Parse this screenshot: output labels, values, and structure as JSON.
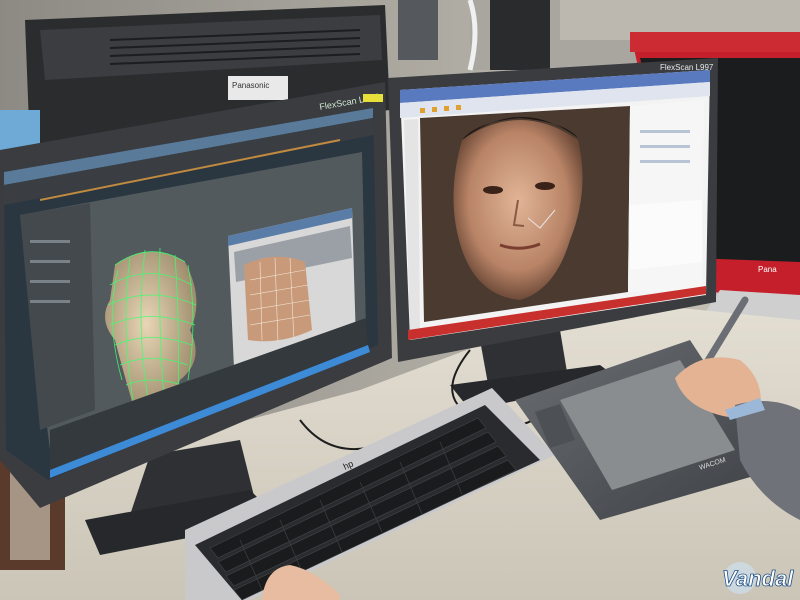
{
  "scene": {
    "left_monitor_brand": "FlexScan L997",
    "right_monitor_brand": "FlexScan L997",
    "back_monitor_brand": "Panasonic",
    "keyboard_brand": "hp",
    "watermark": "Vandal"
  },
  "colors": {
    "desk": "#dcd6c8",
    "wall": "#bfbab0",
    "bezel": "#3a3c40",
    "viewport": "#525a5e",
    "wireframe": "#3cff6e",
    "red_bar": "#c8302e"
  }
}
